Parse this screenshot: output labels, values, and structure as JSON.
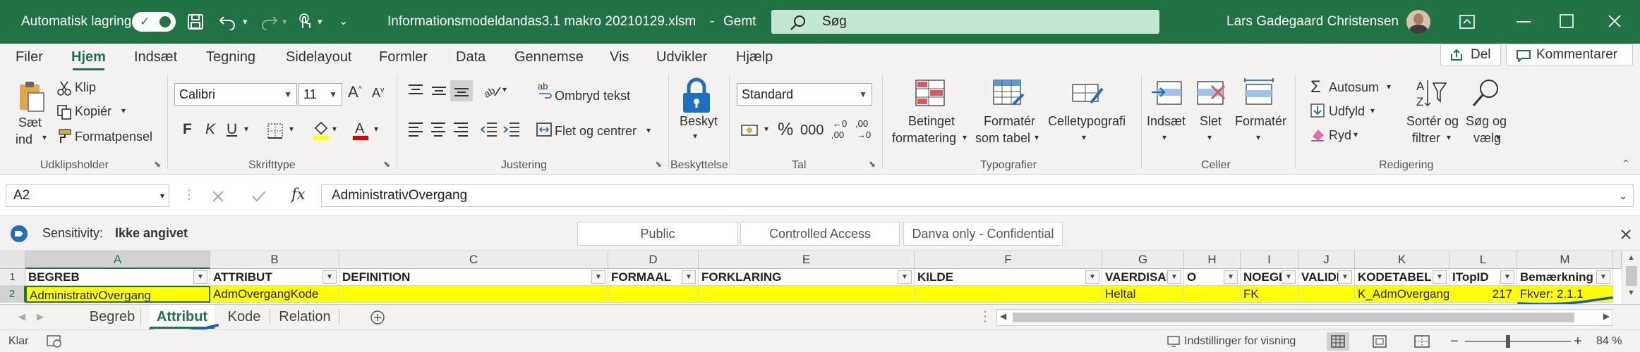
{
  "titlebar": {
    "autosave_label": "Automatisk lagring",
    "filename": "Informationsmodeldandas3.1 makro 20210129.xlsm",
    "saved_sep": "-",
    "saved_status": "Gemt",
    "search_placeholder": "Søg",
    "user_name": "Lars Gadegaard Christensen"
  },
  "menu": {
    "items": [
      "Filer",
      "Hjem",
      "Indsæt",
      "Tegning",
      "Sidelayout",
      "Formler",
      "Data",
      "Gennemse",
      "Vis",
      "Udvikler",
      "Hjælp"
    ],
    "share_label": "Del",
    "comments_label": "Kommentarer"
  },
  "ribbon": {
    "clipboard": {
      "paste_line1": "Sæt",
      "paste_line2": "ind",
      "cut": "Klip",
      "copy": "Kopiér",
      "format_painter": "Formatpensel",
      "group": "Udklipsholder"
    },
    "font": {
      "name": "Calibri",
      "size": "11",
      "bold": "F",
      "italic": "K",
      "underline": "U",
      "group": "Skrifttype"
    },
    "alignment": {
      "wrap": "Ombryd tekst",
      "merge": "Flet og centrer",
      "group": "Justering"
    },
    "protection": {
      "label": "Beskyt",
      "group": "Beskyttelse"
    },
    "number": {
      "format": "Standard",
      "percent": "%",
      "thousands": "000",
      "inc_dec": ",00",
      "dec_dec": ",00",
      "group": "Tal"
    },
    "styles": {
      "cond_line1": "Betinget",
      "cond_line2": "formatering",
      "table_line1": "Formatér",
      "table_line2": "som tabel",
      "cell_styles": "Celletypografi",
      "group": "Typografier"
    },
    "cells": {
      "insert": "Indsæt",
      "delete": "Slet",
      "format": "Formatér",
      "group": "Celler"
    },
    "editing": {
      "autosum": "Autosum",
      "fill": "Udfyld",
      "clear": "Ryd",
      "sort_line1": "Sortér og",
      "sort_line2": "filtrer",
      "find_line1": "Søg og",
      "find_line2": "vælg",
      "group": "Redigering"
    }
  },
  "formula": {
    "name_box": "A2",
    "content": "AdministrativOvergang",
    "fx": "fx"
  },
  "sensitivity": {
    "label": "Sensitivity:",
    "value": "Ikke angivet",
    "options": [
      "Public",
      "Controlled Access",
      "Danva only - Confidential"
    ]
  },
  "grid": {
    "columns": [
      "A",
      "B",
      "C",
      "D",
      "E",
      "F",
      "G",
      "H",
      "I",
      "J",
      "K",
      "L",
      "M"
    ],
    "rows": [
      "1",
      "2"
    ],
    "header_row": [
      "BEGREB",
      "ATTRIBUT",
      "DEFINITION",
      "FORMAAL",
      "FORKLARING",
      "KILDE",
      "VAERDISAE",
      "O",
      "NOEGL",
      "VALIDE",
      "KODETABEL",
      "ITopID",
      "Bemærkning"
    ],
    "data_row": [
      "AdministrativOvergang",
      "AdmOvergangKode",
      "",
      "",
      "",
      "",
      "Heltal",
      "",
      "FK",
      "",
      "K_AdmOvergang",
      "217",
      "Fkver: 2.1.1"
    ]
  },
  "sheets": {
    "tabs": [
      "Begreb",
      "Attribut",
      "Kode",
      "Relation"
    ],
    "active": "Attribut"
  },
  "status": {
    "ready": "Klar",
    "display_settings": "Indstillinger for visning",
    "zoom": "84 %"
  },
  "colors": {
    "excel_green": "#217346",
    "highlight_yellow": "#ffff00",
    "annotation_blue": "#1a5fc7"
  }
}
